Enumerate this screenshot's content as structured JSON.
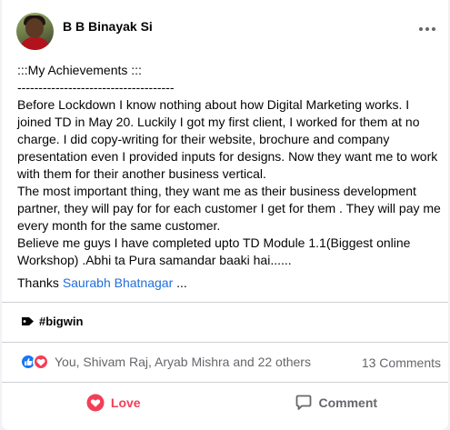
{
  "post": {
    "author_name": "B B Binayak Si",
    "body_text": ":::My Achievements :::\n-------------------------------------\nBefore Lockdown I know nothing about how Digital Marketing works. I joined TD in May 20. Luckily I got my first client, I worked for them at no charge.  I did copy-writing  for their website, brochure and company presentation even I provided inputs for designs. Now they want me to work with them for their another business vertical.\nThe most important thing, they want me as their business development partner, they will pay for for each customer I get for them . They will pay me every month for the same customer.\nBelieve me guys I have completed upto TD Module 1.1(Biggest online Workshop) .Abhi ta Pura samandar baaki hai......",
    "thanks_prefix": "Thanks ",
    "mention": "Saurabh Bhatnagar",
    "thanks_suffix": " ...",
    "hashtag": "#bigwin"
  },
  "reactions": {
    "summary": "You, Shivam Raj, Aryab Mishra and 22 others",
    "comments_count": "13 Comments",
    "types": [
      "like-icon",
      "love-icon"
    ]
  },
  "actions": {
    "love_label": "Love",
    "comment_label": "Comment"
  },
  "colors": {
    "mention": "#216fdb",
    "love": "#f33e58",
    "like": "#1877f2",
    "muted": "#65676b"
  }
}
